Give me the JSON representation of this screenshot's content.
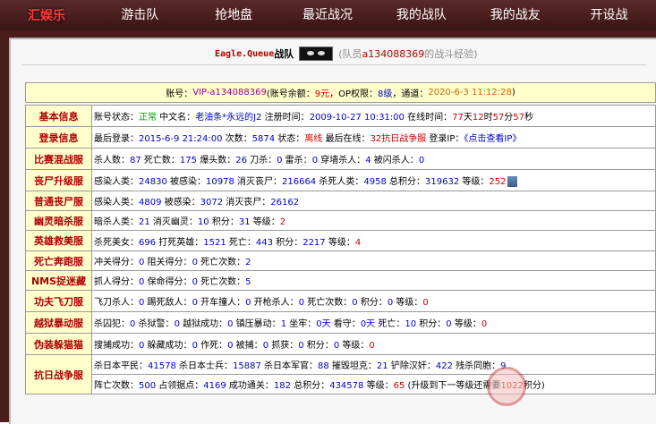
{
  "nav": {
    "logo": "汇娱乐",
    "items": [
      "游击队",
      "抢地盘",
      "最近战况",
      "我的战队",
      "我的战友",
      "开设战"
    ]
  },
  "team": {
    "name": "Eagle.Queue",
    "suffix": "战队",
    "note_prefix": "(队员",
    "note_user": "a134088369",
    "note_suffix": "的战斗经验)"
  },
  "account": {
    "label_account": "账号：",
    "account_id": "VIP-a134088369",
    "label_balance": "(账号余额：",
    "balance": "9元",
    "sep1": "，OP权限：",
    "op_level": "8级",
    "sep2": "，通道：",
    "datetime": "2020-6-3 11:12:28",
    "close": ")"
  },
  "rows": [
    {
      "label": "基本信息",
      "cells": [
        {
          "t": "账号状态：",
          "c": "n"
        },
        {
          "t": "正常",
          "c": "g"
        },
        {
          "t": " 中文名：",
          "c": "n"
        },
        {
          "t": "老油条*永远的J2",
          "c": "b"
        },
        {
          "t": " 注册时间：",
          "c": "n"
        },
        {
          "t": "2009-10-27 10:31:00",
          "c": "b"
        },
        {
          "t": " 在线时间：",
          "c": "n"
        },
        {
          "t": "77",
          "c": "r"
        },
        {
          "t": "天",
          "c": "n"
        },
        {
          "t": "12",
          "c": "r"
        },
        {
          "t": "时",
          "c": "n"
        },
        {
          "t": "57",
          "c": "r"
        },
        {
          "t": "分",
          "c": "n"
        },
        {
          "t": "57",
          "c": "r"
        },
        {
          "t": "秒",
          "c": "n"
        }
      ]
    },
    {
      "label": "登录信息",
      "cells": [
        {
          "t": "最后登录：",
          "c": "n"
        },
        {
          "t": "2015-6-9 21:24:00",
          "c": "b"
        },
        {
          "t": " 次数：",
          "c": "n"
        },
        {
          "t": "5874",
          "c": "b"
        },
        {
          "t": " 状态：",
          "c": "n"
        },
        {
          "t": "离线",
          "c": "r"
        },
        {
          "t": " 最后在线：",
          "c": "n"
        },
        {
          "t": "32抗日战争服",
          "c": "r"
        },
        {
          "t": " 登录IP：",
          "c": "n"
        },
        {
          "t": "《点击查看IP》",
          "c": "b"
        }
      ]
    },
    {
      "label": "比赛混战服",
      "cells": [
        {
          "t": "杀人数：",
          "c": "n"
        },
        {
          "t": "87",
          "c": "b"
        },
        {
          "t": " 死亡数：",
          "c": "n"
        },
        {
          "t": "175",
          "c": "b"
        },
        {
          "t": " 爆头数：",
          "c": "n"
        },
        {
          "t": "26",
          "c": "b"
        },
        {
          "t": " 刀杀：",
          "c": "n"
        },
        {
          "t": "0",
          "c": "b"
        },
        {
          "t": " 雷杀：",
          "c": "n"
        },
        {
          "t": "0",
          "c": "b"
        },
        {
          "t": " 穿墙杀人：",
          "c": "n"
        },
        {
          "t": "4",
          "c": "b"
        },
        {
          "t": " 被闪杀人：",
          "c": "n"
        },
        {
          "t": "0",
          "c": "b"
        }
      ]
    },
    {
      "label": "丧尸升级服",
      "cells": [
        {
          "t": "感染人类：",
          "c": "n"
        },
        {
          "t": "24830",
          "c": "b"
        },
        {
          "t": " 被感染：",
          "c": "n"
        },
        {
          "t": "10978",
          "c": "b"
        },
        {
          "t": " 消灭丧尸：",
          "c": "n"
        },
        {
          "t": "216664",
          "c": "b"
        },
        {
          "t": " 杀死人类：",
          "c": "n"
        },
        {
          "t": "4958",
          "c": "b"
        },
        {
          "t": " 总积分：",
          "c": "n"
        },
        {
          "t": "319632",
          "c": "b"
        },
        {
          "t": " 等级：",
          "c": "n"
        },
        {
          "t": "252",
          "c": "r"
        }
      ],
      "avatar": true
    },
    {
      "label": "普通丧尸服",
      "cells": [
        {
          "t": "感染人类：",
          "c": "n"
        },
        {
          "t": "4809",
          "c": "b"
        },
        {
          "t": " 被感染：",
          "c": "n"
        },
        {
          "t": "3072",
          "c": "b"
        },
        {
          "t": " 消灭丧尸：",
          "c": "n"
        },
        {
          "t": "26162",
          "c": "b"
        }
      ]
    },
    {
      "label": "幽灵暗杀服",
      "cells": [
        {
          "t": "暗杀人类：",
          "c": "n"
        },
        {
          "t": "21",
          "c": "b"
        },
        {
          "t": " 消灭幽灵：",
          "c": "n"
        },
        {
          "t": "10",
          "c": "b"
        },
        {
          "t": " 积分：",
          "c": "n"
        },
        {
          "t": "31",
          "c": "b"
        },
        {
          "t": " 等级：",
          "c": "n"
        },
        {
          "t": "2",
          "c": "r"
        }
      ]
    },
    {
      "label": "英雄救美服",
      "cells": [
        {
          "t": "杀死美女：",
          "c": "n"
        },
        {
          "t": "696",
          "c": "b"
        },
        {
          "t": " 打死英雄：",
          "c": "n"
        },
        {
          "t": "1521",
          "c": "b"
        },
        {
          "t": " 死亡：",
          "c": "n"
        },
        {
          "t": "443",
          "c": "b"
        },
        {
          "t": " 积分：",
          "c": "n"
        },
        {
          "t": "2217",
          "c": "b"
        },
        {
          "t": " 等级：",
          "c": "n"
        },
        {
          "t": "4",
          "c": "r"
        }
      ]
    },
    {
      "label": "死亡奔跑服",
      "cells": [
        {
          "t": "冲关得分：",
          "c": "n"
        },
        {
          "t": "0",
          "c": "b"
        },
        {
          "t": " 阻关得分：",
          "c": "n"
        },
        {
          "t": "0",
          "c": "b"
        },
        {
          "t": " 死亡次数：",
          "c": "n"
        },
        {
          "t": "2",
          "c": "b"
        }
      ]
    },
    {
      "label": "NMS捉迷藏",
      "cells": [
        {
          "t": "抓人得分：",
          "c": "n"
        },
        {
          "t": "0",
          "c": "b"
        },
        {
          "t": " 保命得分：",
          "c": "n"
        },
        {
          "t": "0",
          "c": "b"
        },
        {
          "t": " 死亡次数：",
          "c": "n"
        },
        {
          "t": "5",
          "c": "b"
        }
      ]
    },
    {
      "label": "功夫飞刀服",
      "cells": [
        {
          "t": "飞刀杀人：",
          "c": "n"
        },
        {
          "t": "0",
          "c": "b"
        },
        {
          "t": " 踢死敌人：",
          "c": "n"
        },
        {
          "t": "0",
          "c": "b"
        },
        {
          "t": " 开车撞人：",
          "c": "n"
        },
        {
          "t": "0",
          "c": "b"
        },
        {
          "t": " 开枪杀人：",
          "c": "n"
        },
        {
          "t": "0",
          "c": "b"
        },
        {
          "t": " 死亡次数：",
          "c": "n"
        },
        {
          "t": "0",
          "c": "b"
        },
        {
          "t": " 积分：",
          "c": "n"
        },
        {
          "t": "0",
          "c": "b"
        },
        {
          "t": " 等级：",
          "c": "n"
        },
        {
          "t": "0",
          "c": "r"
        }
      ]
    },
    {
      "label": "越狱暴动服",
      "cells": [
        {
          "t": "杀囚犯：",
          "c": "n"
        },
        {
          "t": "0",
          "c": "b"
        },
        {
          "t": " 杀狱警：",
          "c": "n"
        },
        {
          "t": "0",
          "c": "b"
        },
        {
          "t": " 越狱成功：",
          "c": "n"
        },
        {
          "t": "0",
          "c": "b"
        },
        {
          "t": " 镇压暴动：",
          "c": "n"
        },
        {
          "t": "1",
          "c": "b"
        },
        {
          "t": " 坐牢：",
          "c": "n"
        },
        {
          "t": "0天",
          "c": "b"
        },
        {
          "t": " 看守：",
          "c": "n"
        },
        {
          "t": "0天",
          "c": "b"
        },
        {
          "t": " 死亡：",
          "c": "n"
        },
        {
          "t": "10",
          "c": "b"
        },
        {
          "t": " 积分：",
          "c": "n"
        },
        {
          "t": "0",
          "c": "b"
        },
        {
          "t": " 等级：",
          "c": "n"
        },
        {
          "t": "0",
          "c": "r"
        }
      ]
    },
    {
      "label": "伪装躲猫猫",
      "cells": [
        {
          "t": "搜捕成功：",
          "c": "n"
        },
        {
          "t": "0",
          "c": "b"
        },
        {
          "t": " 躲藏成功：",
          "c": "n"
        },
        {
          "t": "0",
          "c": "b"
        },
        {
          "t": " 作死：",
          "c": "n"
        },
        {
          "t": "0",
          "c": "b"
        },
        {
          "t": " 被捕：",
          "c": "n"
        },
        {
          "t": "0",
          "c": "b"
        },
        {
          "t": " 抓获：",
          "c": "n"
        },
        {
          "t": "0",
          "c": "b"
        },
        {
          "t": " 积分：",
          "c": "n"
        },
        {
          "t": "0",
          "c": "b"
        },
        {
          "t": " 等级：",
          "c": "n"
        },
        {
          "t": "0",
          "c": "r"
        }
      ]
    }
  ],
  "anti_japan": {
    "label": "抗日战争服",
    "line1": [
      {
        "t": "杀日本平民：",
        "c": "n"
      },
      {
        "t": "41578",
        "c": "b"
      },
      {
        "t": " 杀日本士兵：",
        "c": "n"
      },
      {
        "t": "15887",
        "c": "b"
      },
      {
        "t": " 杀日本军官：",
        "c": "n"
      },
      {
        "t": "88",
        "c": "b"
      },
      {
        "t": " 摧毁坦克：",
        "c": "n"
      },
      {
        "t": "21",
        "c": "b"
      },
      {
        "t": " 铲除汉奸：",
        "c": "n"
      },
      {
        "t": "422",
        "c": "b"
      },
      {
        "t": " 残杀同胞：",
        "c": "n"
      },
      {
        "t": "9",
        "c": "b"
      }
    ],
    "line2": [
      {
        "t": "阵亡次数：",
        "c": "n"
      },
      {
        "t": "500",
        "c": "b"
      },
      {
        "t": " 占领据点：",
        "c": "n"
      },
      {
        "t": "4169",
        "c": "b"
      },
      {
        "t": " 成功通关：",
        "c": "n"
      },
      {
        "t": "182",
        "c": "b"
      },
      {
        "t": " 总积分：",
        "c": "n"
      },
      {
        "t": "434578",
        "c": "b"
      },
      {
        "t": " 等级：",
        "c": "n"
      },
      {
        "t": "65",
        "c": "r"
      },
      {
        "t": " (升级到下一等级还需要",
        "c": "n"
      },
      {
        "t": "1022",
        "c": "r"
      },
      {
        "t": "积分)",
        "c": "n"
      }
    ]
  },
  "colors": {
    "nav_bg": "#4a1c1c",
    "label_red": "#b00000",
    "value_blue": "#0000cc",
    "accent_red": "#d00000",
    "ok_green": "#009900"
  }
}
